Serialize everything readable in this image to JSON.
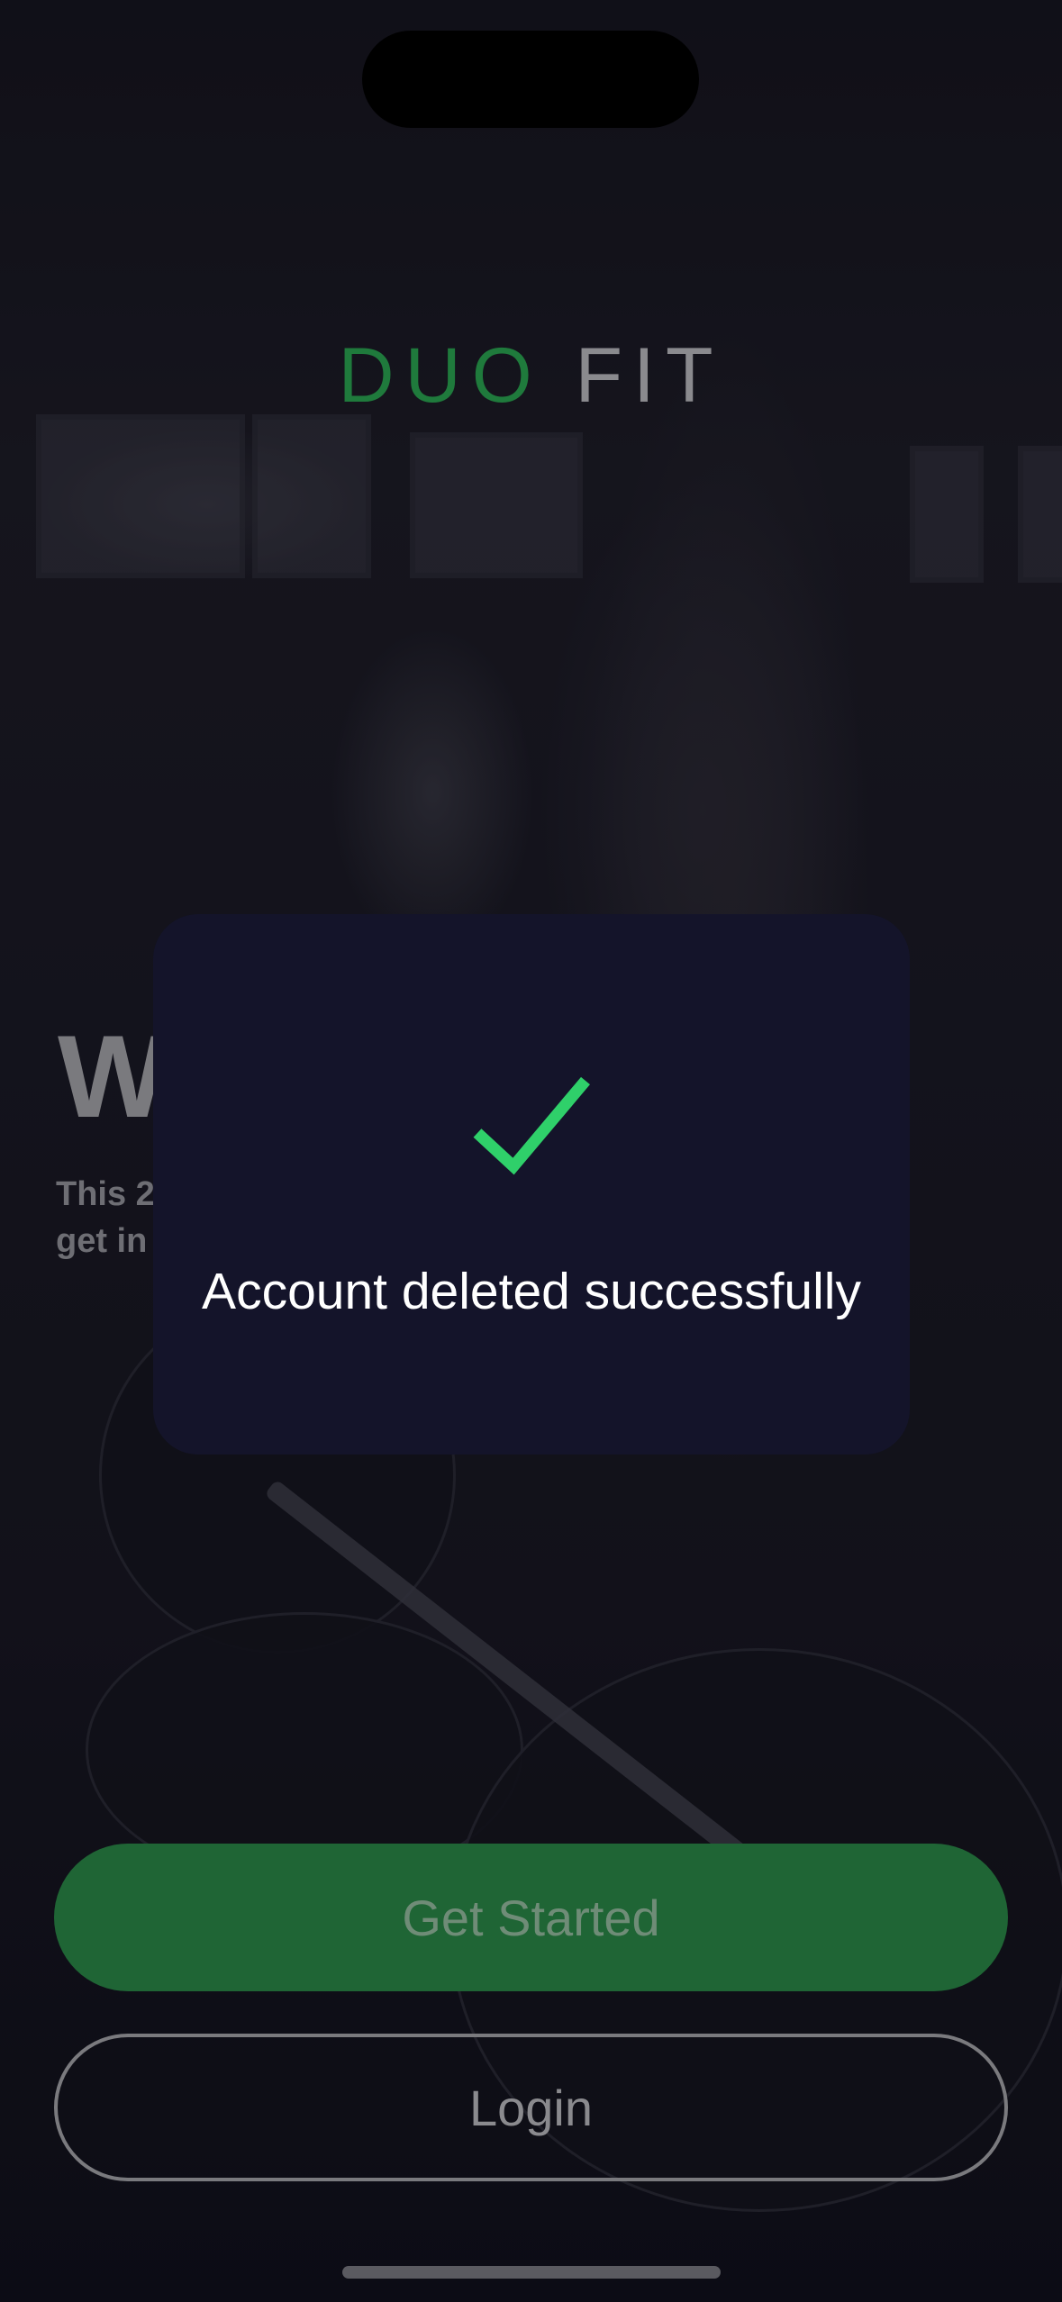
{
  "brand": {
    "word1": "DUO",
    "word2": "FIT",
    "word1_color": "#1f7a3c",
    "word2_color": "#8a8a8e"
  },
  "welcome": {
    "heading": "W",
    "subtext_line1": "This 2",
    "subtext_line2": "get in"
  },
  "dialog": {
    "icon": "checkmark-icon",
    "icon_color": "#2fd06a",
    "message": "Account deleted successfully"
  },
  "actions": {
    "get_started_label": "Get Started",
    "login_label": "Login",
    "primary_color": "#1f6535"
  }
}
